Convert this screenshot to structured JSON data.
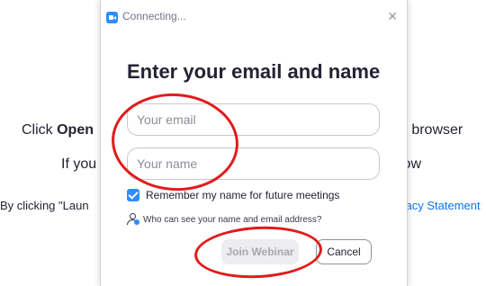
{
  "background": {
    "line1_prefix": "Click ",
    "line1_bold": "Open",
    "line1_suffix": "ir browser",
    "line2_prefix": "If you",
    "line2_suffix": "low",
    "line3_prefix": "By clicking \"Laun",
    "line3_link": "vacy Statement"
  },
  "window": {
    "title": "Connecting...",
    "close_glyph": "✕"
  },
  "form": {
    "heading": "Enter your email and name",
    "email_placeholder": "Your email",
    "email_value": "",
    "name_placeholder": "Your name",
    "name_value": "",
    "remember_label": "Remember my name for future meetings",
    "remember_checked": true,
    "who_can_see": "Who can see your name and email address?"
  },
  "buttons": {
    "join_label": "Join Webinar",
    "join_enabled": false,
    "cancel_label": "Cancel"
  },
  "icons": {
    "app_icon": "zoom-app-icon",
    "close_icon": "close-icon",
    "checkbox_icon": "checkmark-icon",
    "people_icon": "people-icon"
  },
  "colors": {
    "accent": "#2d8cff",
    "annotation": "#e11b1b",
    "link": "#0e72ed"
  }
}
